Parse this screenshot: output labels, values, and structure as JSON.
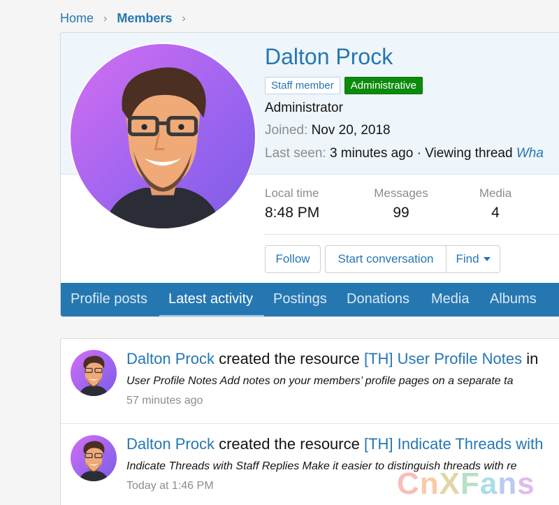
{
  "breadcrumb": [
    "Home",
    "Members"
  ],
  "profile": {
    "name": "Dalton Prock",
    "banners": {
      "staff": "Staff member",
      "admin": "Administrative"
    },
    "title": "Administrator",
    "joined_label": "Joined:",
    "joined_value": "Nov 20, 2018",
    "last_seen_label": "Last seen:",
    "last_seen_value": "3 minutes ago · Viewing thread",
    "last_seen_link": "Wha",
    "stats": {
      "local_time_label": "Local time",
      "local_time_value": "8:48 PM",
      "messages_label": "Messages",
      "messages_value": "99",
      "media_label": "Media",
      "media_value": "4"
    },
    "buttons": {
      "follow": "Follow",
      "start_conversation": "Start conversation",
      "find": "Find"
    }
  },
  "tabs": [
    "Profile posts",
    "Latest activity",
    "Postings",
    "Donations",
    "Media",
    "Albums"
  ],
  "active_tab": "Latest activity",
  "feed": [
    {
      "user": "Dalton Prock",
      "action": " created the resource ",
      "resource": "[TH] User Profile Notes",
      "trail": " in",
      "snippet": "User Profile Notes Add notes on your members’ profile pages on a separate ta",
      "time": "57 minutes ago"
    },
    {
      "user": "Dalton Prock",
      "action": " created the resource ",
      "resource": "[TH] Indicate Threads with",
      "trail": "",
      "snippet": "Indicate Threads with Staff Replies Make it easier to distinguish threads with re",
      "time": "Today at 1:46 PM"
    }
  ],
  "watermark": "CnXFans",
  "colors": {
    "accent": "#2577b1",
    "admin_banner": "#0c8a0c",
    "avatar_bg": "#a866ef"
  }
}
